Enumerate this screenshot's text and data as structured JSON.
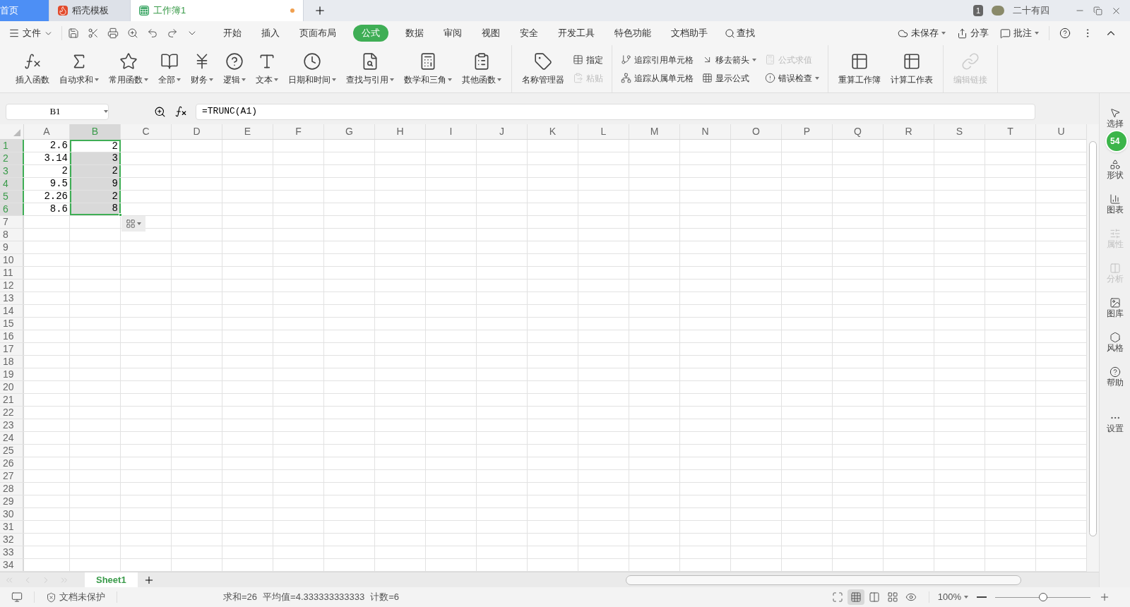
{
  "title_tabs": [
    {
      "label": "首页",
      "kind": "home",
      "selected": false,
      "modified": false
    },
    {
      "label": "稻壳模板",
      "kind": "docer",
      "selected": false,
      "modified": false
    },
    {
      "label": "工作簿1",
      "kind": "sheet",
      "selected": true,
      "modified": true
    }
  ],
  "account": {
    "notifications": "1",
    "user": "二十有四"
  },
  "menu": {
    "file": "文件",
    "tabs": [
      {
        "label": "开始",
        "selected": false
      },
      {
        "label": "插入",
        "selected": false
      },
      {
        "label": "页面布局",
        "selected": false
      },
      {
        "label": "公式",
        "selected": true
      },
      {
        "label": "数据",
        "selected": false
      },
      {
        "label": "审阅",
        "selected": false
      },
      {
        "label": "视图",
        "selected": false
      },
      {
        "label": "安全",
        "selected": false
      },
      {
        "label": "开发工具",
        "selected": false
      },
      {
        "label": "特色功能",
        "selected": false
      },
      {
        "label": "文档助手",
        "selected": false
      }
    ],
    "search": "查找",
    "actions": [
      {
        "label": "未保存",
        "dropdown": true
      },
      {
        "label": "分享",
        "dropdown": false
      },
      {
        "label": "批注",
        "dropdown": true
      }
    ]
  },
  "ribbon": {
    "groups": [
      {
        "items": [
          {
            "label": "插入函数",
            "kind": "large",
            "dropdown": false,
            "disabled": false
          },
          {
            "label": "自动求和",
            "kind": "large",
            "dropdown": true,
            "disabled": false
          },
          {
            "label": "常用函数",
            "kind": "large",
            "dropdown": true,
            "disabled": false
          },
          {
            "label": "全部",
            "kind": "large",
            "dropdown": true,
            "disabled": false
          },
          {
            "label": "财务",
            "kind": "large",
            "dropdown": true,
            "disabled": false
          },
          {
            "label": "逻辑",
            "kind": "large",
            "dropdown": true,
            "disabled": false
          },
          {
            "label": "文本",
            "kind": "large",
            "dropdown": true,
            "disabled": false
          },
          {
            "label": "日期和时间",
            "kind": "large",
            "dropdown": true,
            "disabled": false
          },
          {
            "label": "查找与引用",
            "kind": "large",
            "dropdown": true,
            "disabled": false
          },
          {
            "label": "数学和三角",
            "kind": "large",
            "dropdown": true,
            "disabled": false
          },
          {
            "label": "其他函数",
            "kind": "large",
            "dropdown": true,
            "disabled": false
          }
        ]
      },
      {
        "items": [
          {
            "label": "名称管理器",
            "kind": "large",
            "dropdown": false,
            "disabled": false
          },
          {
            "label": "指定",
            "kind": "small",
            "dropdown": false,
            "disabled": false
          },
          {
            "label": "粘贴",
            "kind": "small",
            "dropdown": false,
            "disabled": true
          }
        ]
      },
      {
        "items": [
          {
            "label": "追踪引用单元格",
            "kind": "small",
            "dropdown": false,
            "disabled": false
          },
          {
            "label": "追踪从属单元格",
            "kind": "small",
            "dropdown": false,
            "disabled": false
          },
          {
            "label": "移去箭头",
            "kind": "small",
            "dropdown": true,
            "disabled": false
          },
          {
            "label": "显示公式",
            "kind": "small",
            "dropdown": false,
            "disabled": false
          },
          {
            "label": "公式求值",
            "kind": "small",
            "dropdown": false,
            "disabled": true
          },
          {
            "label": "错误检查",
            "kind": "small",
            "dropdown": true,
            "disabled": false
          }
        ]
      },
      {
        "items": [
          {
            "label": "重算工作簿",
            "kind": "large",
            "dropdown": false,
            "disabled": false
          },
          {
            "label": "计算工作表",
            "kind": "large",
            "dropdown": false,
            "disabled": false
          }
        ]
      },
      {
        "items": [
          {
            "label": "编辑链接",
            "kind": "large",
            "dropdown": false,
            "disabled": true
          }
        ]
      }
    ]
  },
  "formula_bar": {
    "name_box": "B1",
    "formula": "=TRUNC(A1)"
  },
  "sheet": {
    "columns": [
      {
        "label": "A",
        "selected": false
      },
      {
        "label": "B",
        "selected": true
      },
      {
        "label": "C",
        "selected": false
      },
      {
        "label": "D",
        "selected": false
      },
      {
        "label": "E",
        "selected": false
      },
      {
        "label": "F",
        "selected": false
      },
      {
        "label": "G",
        "selected": false
      },
      {
        "label": "H",
        "selected": false
      },
      {
        "label": "I",
        "selected": false
      },
      {
        "label": "J",
        "selected": false
      },
      {
        "label": "K",
        "selected": false
      },
      {
        "label": "L",
        "selected": false
      },
      {
        "label": "M",
        "selected": false
      },
      {
        "label": "N",
        "selected": false
      },
      {
        "label": "O",
        "selected": false
      },
      {
        "label": "P",
        "selected": false
      },
      {
        "label": "Q",
        "selected": false
      },
      {
        "label": "R",
        "selected": false
      },
      {
        "label": "S",
        "selected": false
      },
      {
        "label": "T",
        "selected": false
      },
      {
        "label": "U",
        "selected": false
      }
    ],
    "rows": [
      {
        "label": "1",
        "selected": true,
        "cells": [
          {
            "value": "2.6",
            "selected": false
          },
          {
            "value": "2",
            "selected": true,
            "active": true
          }
        ]
      },
      {
        "label": "2",
        "selected": true,
        "cells": [
          {
            "value": "3.14",
            "selected": false
          },
          {
            "value": "3",
            "selected": true,
            "active": false
          }
        ]
      },
      {
        "label": "3",
        "selected": true,
        "cells": [
          {
            "value": "2",
            "selected": false
          },
          {
            "value": "2",
            "selected": true,
            "active": false
          }
        ]
      },
      {
        "label": "4",
        "selected": true,
        "cells": [
          {
            "value": "9.5",
            "selected": false
          },
          {
            "value": "9",
            "selected": true,
            "active": false
          }
        ]
      },
      {
        "label": "5",
        "selected": true,
        "cells": [
          {
            "value": "2.26",
            "selected": false
          },
          {
            "value": "2",
            "selected": true,
            "active": false
          }
        ]
      },
      {
        "label": "6",
        "selected": true,
        "cells": [
          {
            "value": "8.6",
            "selected": false
          },
          {
            "value": "8",
            "selected": true,
            "active": false
          }
        ]
      },
      {
        "label": "7",
        "selected": false,
        "cells": []
      },
      {
        "label": "8",
        "selected": false,
        "cells": []
      },
      {
        "label": "9",
        "selected": false,
        "cells": []
      },
      {
        "label": "10",
        "selected": false,
        "cells": []
      },
      {
        "label": "11",
        "selected": false,
        "cells": []
      },
      {
        "label": "12",
        "selected": false,
        "cells": []
      },
      {
        "label": "13",
        "selected": false,
        "cells": []
      },
      {
        "label": "14",
        "selected": false,
        "cells": []
      },
      {
        "label": "15",
        "selected": false,
        "cells": []
      },
      {
        "label": "16",
        "selected": false,
        "cells": []
      },
      {
        "label": "17",
        "selected": false,
        "cells": []
      },
      {
        "label": "18",
        "selected": false,
        "cells": []
      },
      {
        "label": "19",
        "selected": false,
        "cells": []
      },
      {
        "label": "20",
        "selected": false,
        "cells": []
      },
      {
        "label": "21",
        "selected": false,
        "cells": []
      },
      {
        "label": "22",
        "selected": false,
        "cells": []
      },
      {
        "label": "23",
        "selected": false,
        "cells": []
      },
      {
        "label": "24",
        "selected": false,
        "cells": []
      },
      {
        "label": "25",
        "selected": false,
        "cells": []
      },
      {
        "label": "26",
        "selected": false,
        "cells": []
      },
      {
        "label": "27",
        "selected": false,
        "cells": []
      },
      {
        "label": "28",
        "selected": false,
        "cells": []
      },
      {
        "label": "29",
        "selected": false,
        "cells": []
      },
      {
        "label": "30",
        "selected": false,
        "cells": []
      },
      {
        "label": "31",
        "selected": false,
        "cells": []
      },
      {
        "label": "32",
        "selected": false,
        "cells": []
      },
      {
        "label": "33",
        "selected": false,
        "cells": []
      },
      {
        "label": "34",
        "selected": false,
        "cells": []
      }
    ]
  },
  "sidebar": {
    "items": [
      {
        "label": "选择",
        "disabled": false
      },
      {
        "label": "形状",
        "disabled": false
      },
      {
        "label": "图表",
        "disabled": false
      },
      {
        "label": "属性",
        "disabled": true
      },
      {
        "label": "分析",
        "disabled": true
      },
      {
        "label": "图库",
        "disabled": false
      },
      {
        "label": "风格",
        "disabled": false
      },
      {
        "label": "帮助",
        "disabled": false
      },
      {
        "label": "设置",
        "disabled": false
      }
    ],
    "speed_badge": "54"
  },
  "sheet_tabs": [
    {
      "label": "Sheet1",
      "selected": true
    }
  ],
  "status_bar": {
    "protection": "文档未保护",
    "stats": [
      "求和=26",
      "平均值=4.333333333333",
      "计数=6"
    ],
    "view_buttons": [
      {
        "selected": false
      },
      {
        "selected": true
      },
      {
        "selected": false
      },
      {
        "selected": false
      },
      {
        "selected": false
      }
    ],
    "zoom": "100%",
    "zoom_slider": {
      "level": 0.5
    }
  }
}
